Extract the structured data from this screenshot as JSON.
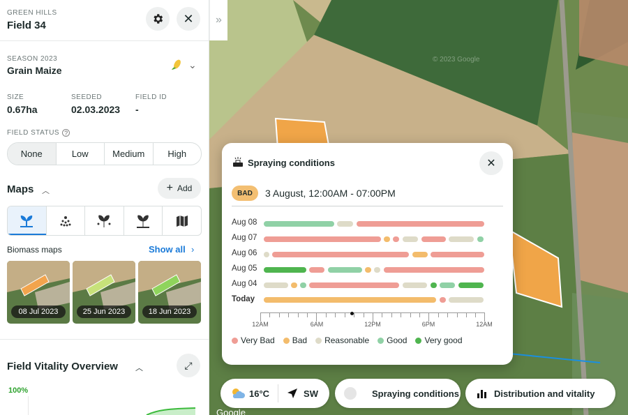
{
  "header": {
    "farm": "GREEN HILLS",
    "field": "Field 34"
  },
  "season": {
    "label": "SEASON 2023",
    "crop": "Grain Maize"
  },
  "stats": [
    {
      "label": "SIZE",
      "value": "0.67ha"
    },
    {
      "label": "SEEDED",
      "value": "02.03.2023"
    },
    {
      "label": "FIELD ID",
      "value": "-"
    }
  ],
  "field_status": {
    "title": "FIELD STATUS",
    "options": [
      "None",
      "Low",
      "Medium",
      "High"
    ],
    "selected": "None"
  },
  "maps": {
    "title": "Maps",
    "add_label": "Add"
  },
  "biomass": {
    "title": "Biomass maps",
    "show_all": "Show all",
    "dates": [
      "08 Jul 2023",
      "25 Jun 2023",
      "18 Jun 2023"
    ]
  },
  "vitality": {
    "title": "Field Vitality Overview",
    "pct": "100%"
  },
  "spraying": {
    "title": "Spraying conditions",
    "badge": "BAD",
    "range": "3 August, 12:00AM - 07:00PM",
    "days": [
      "Aug 08",
      "Aug 07",
      "Aug 06",
      "Aug 05",
      "Aug 04",
      "Today"
    ],
    "time_labels": [
      "12AM",
      "6AM",
      "12PM",
      "6PM",
      "12AM"
    ],
    "legend": [
      {
        "label": "Very Bad",
        "color": "#ef9d95"
      },
      {
        "label": "Bad",
        "color": "#f3bc6c"
      },
      {
        "label": "Reasonable",
        "color": "#dedbc8"
      },
      {
        "label": "Good",
        "color": "#90d1a6"
      },
      {
        "label": "Very good",
        "color": "#4fb54f"
      }
    ]
  },
  "bottom": {
    "temp": "16°C",
    "wind": "SW",
    "spraying_btn": "Spraying conditions",
    "distribution_btn": "Distribution and vitality"
  },
  "map_watermarks": [
    "© 2023 Google",
    "Google"
  ]
}
